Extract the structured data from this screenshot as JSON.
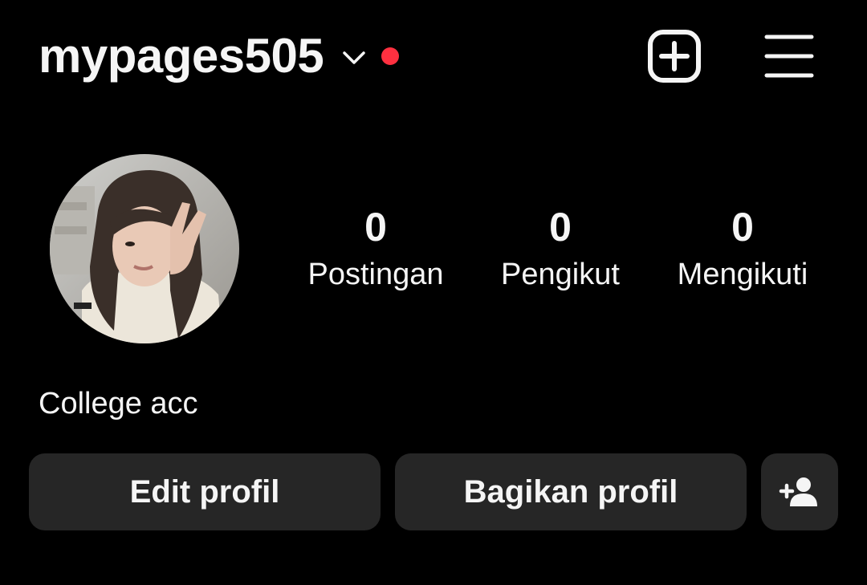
{
  "header": {
    "username": "mypages505",
    "chevron_icon": "chevron-down-icon",
    "notification_dot_color": "#ff3040",
    "new_post_icon": "plus-square-icon",
    "menu_icon": "hamburger-menu-icon"
  },
  "profile": {
    "avatar_icon": "profile-photo",
    "stats": [
      {
        "value": "0",
        "label": "Postingan"
      },
      {
        "value": "0",
        "label": "Pengikut"
      },
      {
        "value": "0",
        "label": "Mengikuti"
      }
    ],
    "bio": "College acc"
  },
  "actions": {
    "edit_label": "Edit profil",
    "share_label": "Bagikan profil",
    "add_person_icon": "add-person-icon",
    "button_color": "#262626"
  }
}
